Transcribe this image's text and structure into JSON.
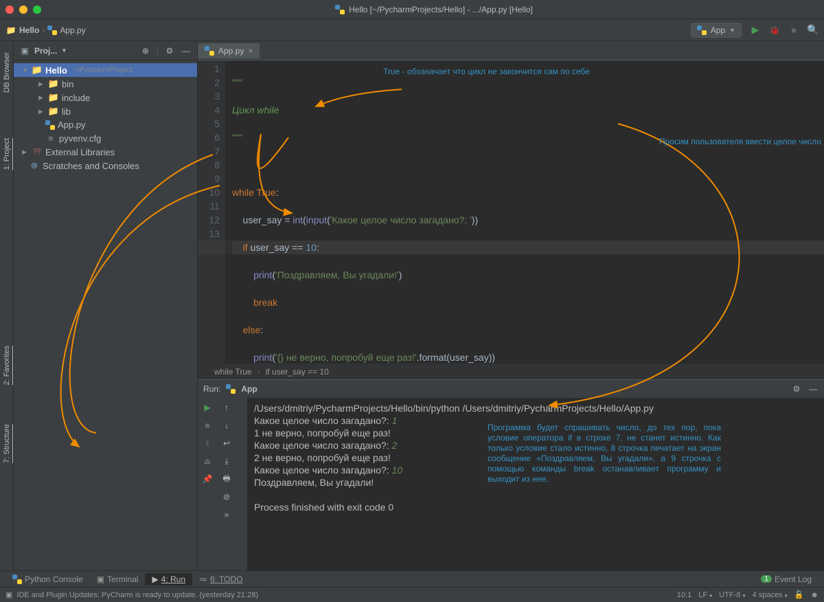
{
  "window": {
    "title": "Hello [~/PycharmProjects/Hello] - .../App.py [Hello]"
  },
  "navbar": {
    "breadcrumb": [
      "Hello",
      "App.py"
    ],
    "run_config": "App"
  },
  "sidebar": {
    "title": "Proj...",
    "tree": {
      "root_name": "Hello",
      "root_path": "~/PycharmProject",
      "children": [
        {
          "name": "bin",
          "type": "folder"
        },
        {
          "name": "include",
          "type": "folder"
        },
        {
          "name": "lib",
          "type": "folder"
        },
        {
          "name": "App.py",
          "type": "py"
        },
        {
          "name": "pyvenv.cfg",
          "type": "file"
        }
      ],
      "external": "External Libraries",
      "scratches": "Scratches and Consoles"
    }
  },
  "left_tabs": {
    "db_browser": "DB Browser",
    "project": "1: Project",
    "favorites": "2: Favorites",
    "structure": "7: Structure"
  },
  "editor": {
    "tab_name": "App.py",
    "lines": [
      "\"\"\"",
      "Цикл while",
      "\"\"\"",
      "",
      "while True:",
      "    user_say = int(input('Какое целое число загадано?: '))",
      "    if user_say == 10:",
      "        print('Поздравляем, Вы угадали!')",
      "        break",
      "    else:",
      "        print('{} не верно, попробуй еще раз!'.format(user_say))",
      "",
      ""
    ],
    "breadcrumb": [
      "while True",
      "if user_say == 10"
    ]
  },
  "annotations": {
    "top": "True - обозначает что цикл не закончится сам по себе",
    "right": "Просим пользователя ввести целое число",
    "bottom": "Программа будет спрашивать число, до тех пор, пока условие оператора if в строке 7, не станет истинно. Как только условие стало истинно, 8 строчка печатает на экран сообщение «Поздравляем, Вы угадали», а 9 строчка с помощью команды break останавливает программу и выходит из нее."
  },
  "run": {
    "title": "Run:",
    "config": "App",
    "output": [
      "/Users/dmitriy/PycharmProjects/Hello/bin/python /Users/dmitriy/PycharmProjects/Hello/App.py",
      {
        "prompt": "Какое целое число загадано?: ",
        "input": "1"
      },
      "1 не верно, попробуй еще раз!",
      {
        "prompt": "Какое целое число загадано?: ",
        "input": "2"
      },
      "2 не верно, попробуй еще раз!",
      {
        "prompt": "Какое целое число загадано?: ",
        "input": "10"
      },
      "Поздравляем, Вы угадали!",
      "",
      "Process finished with exit code 0"
    ]
  },
  "bottom_tabs": {
    "python_console": "Python Console",
    "terminal": "Terminal",
    "run": "4: Run",
    "todo": "6: TODO",
    "event_log": "Event Log",
    "event_count": "1"
  },
  "status": {
    "message": "IDE and Plugin Updates: PyCharm is ready to update. (yesterday 21:28)",
    "position": "10:1",
    "line_sep": "LF",
    "encoding": "UTF-8",
    "indent": "4 spaces"
  }
}
